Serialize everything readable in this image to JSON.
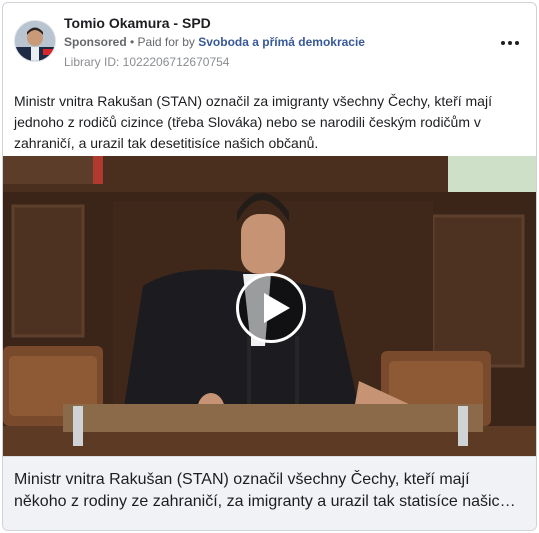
{
  "post": {
    "page_name": "Tomio Okamura - SPD",
    "sponsored_label": "Sponsored",
    "separator": " • ",
    "paid_for_prefix": "Paid for by ",
    "paid_for_by": "Svoboda a přímá demokracie",
    "library_id": "Library ID: 1022206712670754",
    "body_text": "Ministr vnitra Rakušan (STAN) označil za imigranty všechny Čechy, kteří mají jednoho z rodičů cizince (třeba Slováka) nebo se narodili českým rodičům v zahraničí, a urazil tak desetitisíce našich občanů.",
    "caption": "Ministr vnitra Rakušan (STAN) označil všechny Čechy, kteří mají někoho z rodiny ze zahraničí, za imigranty a urazil tak statisíce našich občanů."
  },
  "icons": {
    "menu": "more-horizontal-icon",
    "play": "play-icon"
  },
  "colors": {
    "link": "#385898",
    "caption_bg": "#f0f2f5",
    "video_bg": "#2a1b12"
  }
}
